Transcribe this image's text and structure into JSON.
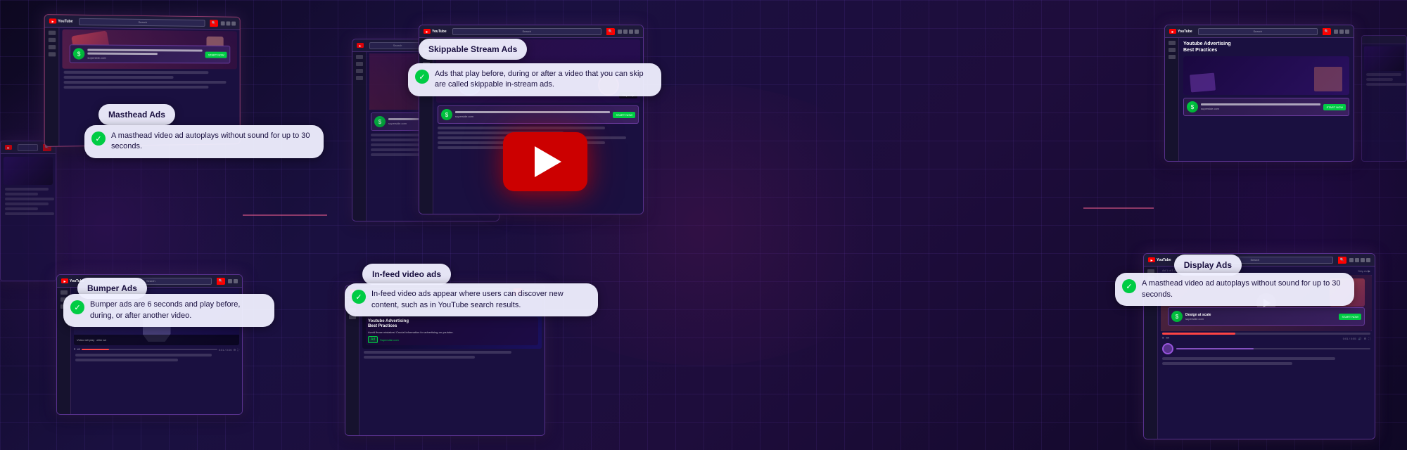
{
  "background": {
    "gradient_start": "#0d0820",
    "gradient_end": "#1e0d3c",
    "grid_color": "rgba(100,60,180,0.15)"
  },
  "tooltips": {
    "masthead_title": "Masthead Ads",
    "masthead_desc": "A masthead video ad autoplays without sound for up to 30 seconds.",
    "skippable_title": "Skippable Stream Ads",
    "skippable_desc": "Ads that play before, during or after a video that you can skip are called skippable in-stream ads.",
    "infeed_title": "In-feed video ads",
    "infeed_desc": "In-feed video ads appear where users can discover new content, such as in YouTube search results.",
    "bumper_title": "Bumper Ads",
    "bumper_desc": "Bumper ads are 6 seconds and play before, during, or after another video.",
    "display_title": "Display Ads",
    "display_desc": "A masthead video ad autoplays without sound for up to 30 seconds."
  },
  "youtube_screens": {
    "search_placeholder": "Search",
    "search_btn": "🔍",
    "logo_text": "YouTube",
    "start_now_btn": "START NOW",
    "design_at_scale": "Design at scale",
    "superside_url": "superside.com",
    "skip_ad": "Skip Ad ▶",
    "ad_label": "Ad",
    "superside_label": "Superside.com",
    "ytads_title": "Youtube Advertising\nBest Practices",
    "ytads_subtitle": "Avoid those mistakes! Crucial information for advertising on youtube."
  }
}
